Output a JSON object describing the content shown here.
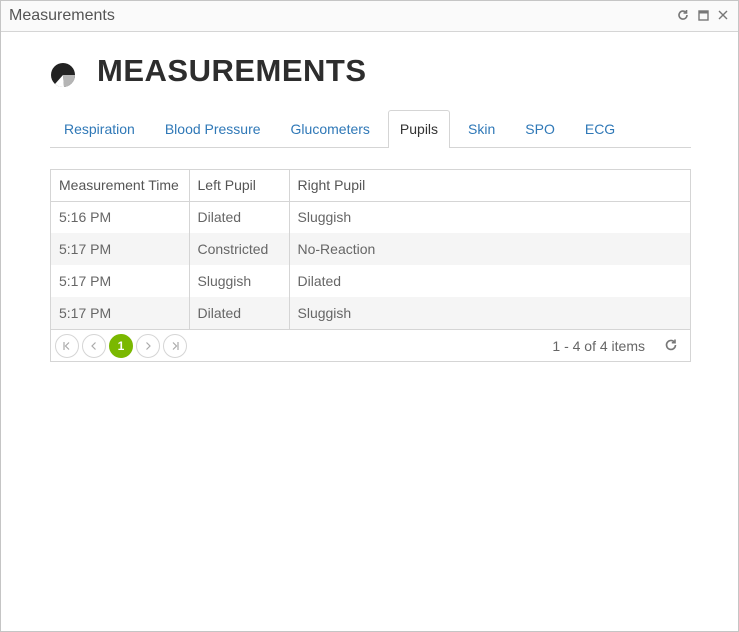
{
  "window": {
    "title": "Measurements",
    "icons": [
      "refresh-icon",
      "maximize-icon",
      "close-icon"
    ]
  },
  "header": {
    "title": "MEASUREMENTS",
    "logo_icon": "pie-chart-icon"
  },
  "tabs": [
    {
      "label": "Respiration",
      "active": false
    },
    {
      "label": "Blood Pressure",
      "active": false
    },
    {
      "label": "Glucometers",
      "active": false
    },
    {
      "label": "Pupils",
      "active": true
    },
    {
      "label": "Skin",
      "active": false
    },
    {
      "label": "SPO",
      "active": false
    },
    {
      "label": "ECG",
      "active": false
    }
  ],
  "grid": {
    "columns": [
      "Measurement Time",
      "Left Pupil",
      "Right Pupil"
    ],
    "rows": [
      [
        "5:16 PM",
        "Dilated",
        "Sluggish"
      ],
      [
        "5:17 PM",
        "Constricted",
        "No-Reaction"
      ],
      [
        "5:17 PM",
        "Sluggish",
        "Dilated"
      ],
      [
        "5:17 PM",
        "Dilated",
        "Sluggish"
      ]
    ]
  },
  "pager": {
    "current_page": "1",
    "info": "1 - 4 of 4 items"
  },
  "colors": {
    "link": "#2f78b7",
    "accent": "#7ab800",
    "border": "#d5d5d5",
    "alt_row": "#f5f5f5"
  }
}
